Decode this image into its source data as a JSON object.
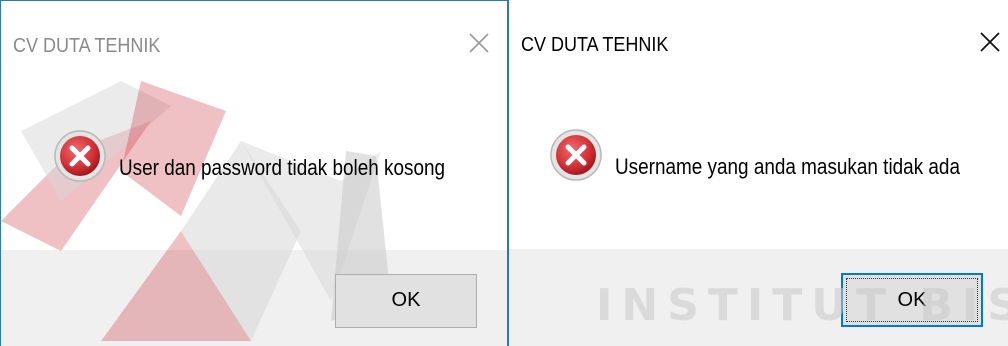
{
  "dialogs": [
    {
      "title": "CV DUTA TEHNIK",
      "message": "User dan password tidak boleh kosong",
      "ok_label": "OK",
      "icon": "error-icon",
      "close_icon": "close-icon"
    },
    {
      "title": "CV DUTA TEHNIK",
      "message": "Username yang anda masukan tidak ada",
      "ok_label": "OK",
      "icon": "error-icon",
      "close_icon": "close-icon"
    }
  ],
  "watermark": {
    "text": "INSTITUT BISNIS"
  },
  "colors": {
    "accent": "#0078d7",
    "error_red": "#d9343a",
    "watermark_red": "#c8202a",
    "footer_bg": "#f0f0f0"
  }
}
